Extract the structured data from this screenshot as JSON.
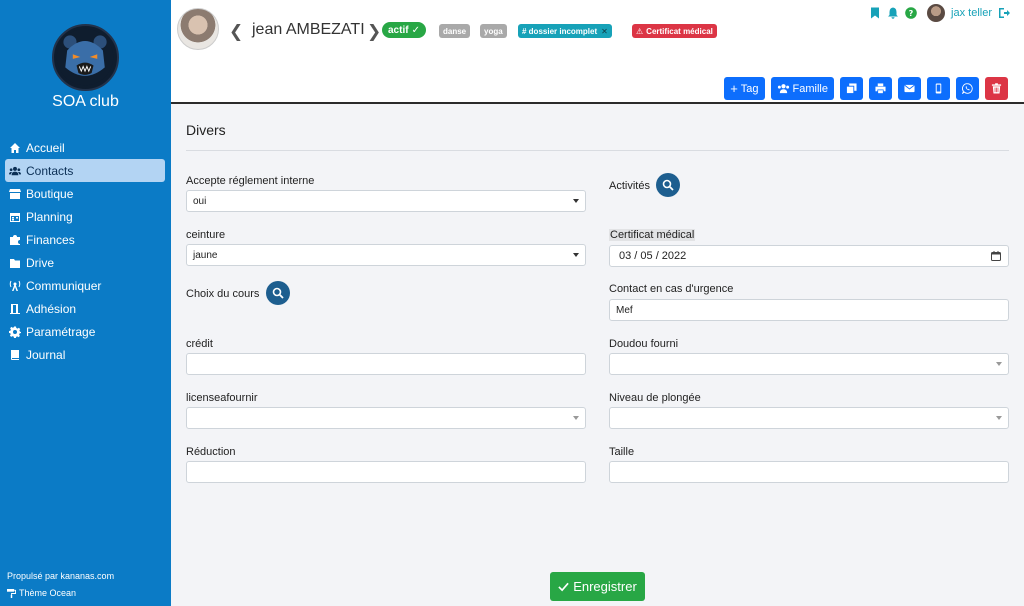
{
  "app": {
    "club_name": "SOA club",
    "powered_by": "Propulsé par kananas.com",
    "theme": "Thème Ocean"
  },
  "nav": {
    "items": [
      {
        "label": "Accueil",
        "icon": "home-icon"
      },
      {
        "label": "Contacts",
        "icon": "users-icon",
        "active": true
      },
      {
        "label": "Boutique",
        "icon": "store-icon"
      },
      {
        "label": "Planning",
        "icon": "calendar-icon"
      },
      {
        "label": "Finances",
        "icon": "puzzle-icon"
      },
      {
        "label": "Drive",
        "icon": "folder-icon"
      },
      {
        "label": "Communiquer",
        "icon": "broadcast-icon"
      },
      {
        "label": "Adhésion",
        "icon": "door-icon"
      },
      {
        "label": "Paramétrage",
        "icon": "gear-icon"
      },
      {
        "label": "Journal",
        "icon": "book-icon"
      }
    ]
  },
  "contact": {
    "name": "jean AMBEZATI",
    "status": "actif",
    "tags": [
      "danse",
      "yoga"
    ],
    "dossier_badge": "# dossier incomplet",
    "dossier_remove": "✕",
    "certificat_badge": "Certificat médical"
  },
  "user": {
    "name": "jax teller"
  },
  "actions": {
    "tag_label": "Tag",
    "famille_label": "Famille"
  },
  "section": {
    "title": "Divers"
  },
  "form": {
    "accepte_label": "Accepte réglement interne",
    "accepte_value": "oui",
    "ceinture_label": "ceinture",
    "ceinture_value": "jaune",
    "choix_label": "Choix du cours",
    "credit_label": "crédit",
    "credit_value": "",
    "license_label": "licenseafournir",
    "license_value": "",
    "reduction_label": "Réduction",
    "reduction_value": "",
    "activites_label": "Activités",
    "certificat_label": "Certificat médical",
    "certificat_value": "03 / 05 / 2022",
    "contact_urgence_label": "Contact en cas d'urgence",
    "contact_urgence_value": "Mef",
    "doudou_label": "Doudou fourni",
    "doudou_value": "",
    "niveau_label": "Niveau de plongée",
    "niveau_value": "",
    "taille_label": "Taille",
    "taille_value": ""
  },
  "save": {
    "label": "Enregistrer"
  },
  "colors": {
    "sidebar": "#0b7bc6",
    "primary": "#0d6efd",
    "success": "#28a745",
    "danger": "#dc3545",
    "info": "#17a2b8"
  }
}
